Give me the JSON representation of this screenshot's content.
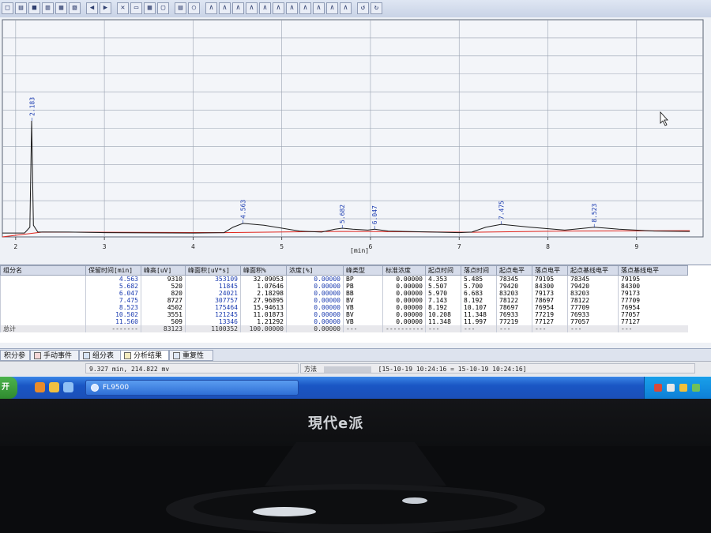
{
  "toolbar": {
    "icons": [
      "new-file-icon",
      "open-folder-icon",
      "save-icon",
      "print-icon",
      "copy-icon",
      "export-icon",
      "undo-icon",
      "redo-icon",
      "delete-icon",
      "edit-icon",
      "grid-icon",
      "window-icon",
      "table-icon",
      "zoom-icon",
      "peak-tool-1-icon",
      "peak-tool-2-icon",
      "peak-tool-3-icon",
      "peak-tool-4-icon",
      "peak-tool-5-icon",
      "peak-tool-6-icon",
      "peak-tool-7-icon",
      "peak-tool-8-icon",
      "peak-tool-9-icon",
      "peak-tool-10-icon",
      "peak-tool-11-icon",
      "refresh-icon",
      "refresh-all-icon"
    ]
  },
  "chart_data": {
    "type": "line",
    "xlabel": "[min]",
    "xlim": [
      1.85,
      9.75
    ],
    "x_ticks": [
      "2",
      "3",
      "4",
      "5",
      "6",
      "7",
      "8",
      "9"
    ],
    "signal": {
      "x": [
        1.85,
        2.1,
        2.16,
        2.18,
        2.2,
        2.25,
        2.6,
        3.0,
        4.0,
        4.35,
        4.45,
        4.563,
        4.8,
        5.2,
        5.45,
        5.5,
        5.6,
        5.682,
        5.8,
        5.97,
        6.047,
        6.2,
        7.0,
        7.143,
        7.3,
        7.475,
        7.8,
        8.19,
        8.3,
        8.523,
        8.8,
        9.2,
        9.6
      ],
      "y": [
        0.02,
        0.02,
        0.05,
        0.6,
        0.06,
        0.025,
        0.025,
        0.022,
        0.02,
        0.022,
        0.05,
        0.07,
        0.06,
        0.03,
        0.025,
        0.03,
        0.04,
        0.045,
        0.04,
        0.035,
        0.04,
        0.03,
        0.022,
        0.025,
        0.05,
        0.065,
        0.05,
        0.035,
        0.04,
        0.05,
        0.04,
        0.03,
        0.028
      ]
    },
    "baseline": {
      "x": [
        1.85,
        2.3,
        4.353,
        5.485,
        5.97,
        7.143,
        8.192,
        9.6
      ],
      "y": [
        0.0,
        0.025,
        0.022,
        0.028,
        0.028,
        0.024,
        0.03,
        0.032
      ]
    },
    "peak_labels": [
      {
        "x": 2.183,
        "y": 0.6,
        "label": "2.183"
      },
      {
        "x": 4.563,
        "y": 0.07,
        "label": "4.563"
      },
      {
        "x": 5.682,
        "y": 0.045,
        "label": "5.682"
      },
      {
        "x": 6.047,
        "y": 0.04,
        "label": "6.047"
      },
      {
        "x": 7.475,
        "y": 0.065,
        "label": "7.475"
      },
      {
        "x": 8.523,
        "y": 0.05,
        "label": "8.523"
      }
    ]
  },
  "table": {
    "headers": [
      "组分名",
      "保留时间[min]",
      "峰高[uV]",
      "峰面积[uV*s]",
      "峰面积%",
      "浓度[%]",
      "峰类型",
      "标准浓度",
      "起点时间",
      "落点时间",
      "起点电平",
      "落点电平",
      "起点基线电平",
      "落点基线电平"
    ],
    "rows": [
      [
        "",
        "4.563",
        "9310",
        "353109",
        "32.09053",
        "0.00000",
        "BP",
        "0.00000",
        "4.353",
        "5.485",
        "78345",
        "79195",
        "78345",
        "79195"
      ],
      [
        "",
        "5.682",
        "520",
        "11845",
        "1.07646",
        "0.00000",
        "PB",
        "0.00000",
        "5.507",
        "5.700",
        "79420",
        "84300",
        "79420",
        "84300"
      ],
      [
        "",
        "6.047",
        "820",
        "24021",
        "2.18298",
        "0.00000",
        "BB",
        "0.00000",
        "5.970",
        "6.683",
        "83203",
        "79173",
        "83203",
        "79173"
      ],
      [
        "",
        "7.475",
        "8727",
        "307757",
        "27.96895",
        "0.00000",
        "BV",
        "0.00000",
        "7.143",
        "8.192",
        "78122",
        "78697",
        "78122",
        "77709"
      ],
      [
        "",
        "8.523",
        "4502",
        "175464",
        "15.94613",
        "0.00000",
        "VB",
        "0.00000",
        "8.192",
        "10.107",
        "78697",
        "76954",
        "77709",
        "76954"
      ],
      [
        "",
        "10.502",
        "3551",
        "121245",
        "11.01873",
        "0.00000",
        "BV",
        "0.00000",
        "10.208",
        "11.348",
        "76933",
        "77219",
        "76933",
        "77057"
      ],
      [
        "",
        "11.560",
        "509",
        "13346",
        "1.21292",
        "0.00000",
        "VB",
        "0.00000",
        "11.348",
        "11.997",
        "77219",
        "77127",
        "77057",
        "77127"
      ]
    ],
    "total": [
      "总计",
      "-------",
      "83123",
      "1100352",
      "100.00000",
      "0.00000",
      "---",
      "----------",
      "---",
      "---",
      "---",
      "---",
      "---",
      "---"
    ]
  },
  "tabs": [
    {
      "label": "积分参数",
      "icon": "params-icon"
    },
    {
      "label": "手动事件",
      "icon": "manual-event-icon"
    },
    {
      "label": "组分表",
      "icon": "component-table-icon"
    },
    {
      "label": "分析结果",
      "icon": "analysis-result-icon"
    },
    {
      "label": "重复性",
      "icon": "repeatability-icon"
    }
  ],
  "status": {
    "cursor": "9.327 min, 214.822 mv",
    "method_label": "方法",
    "method_value": "[15-10-19 10:24:16 = 15-10-19 10:24:16]"
  },
  "taskbar": {
    "start_label": "开",
    "task_label": "FL9500"
  },
  "monitor": {
    "brand": "現代e派"
  },
  "colors": {
    "signal": "#1a1a1a",
    "baseline": "#e0261d",
    "peak_label": "#1a3bb0",
    "grid": "#9aa3b2"
  }
}
